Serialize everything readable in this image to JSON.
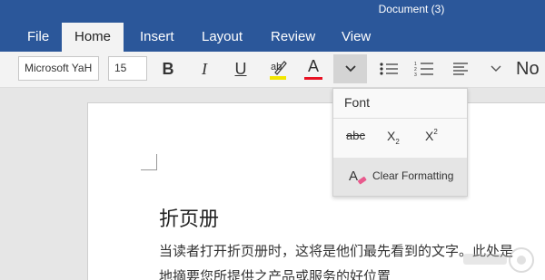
{
  "window": {
    "title": "Document (3)"
  },
  "tabs": [
    {
      "label": "File"
    },
    {
      "label": "Home",
      "active": true
    },
    {
      "label": "Insert"
    },
    {
      "label": "Layout"
    },
    {
      "label": "Review"
    },
    {
      "label": "View"
    }
  ],
  "ribbon": {
    "font_name": "Microsoft YaH",
    "font_size": "15",
    "bold_label": "B",
    "italic_label": "I",
    "underline_label": "U",
    "font_color_label": "A",
    "styles_label": "No",
    "colors": {
      "highlight": "#f2e600",
      "font_color": "#e81123",
      "accent": "#2b579a"
    }
  },
  "font_panel": {
    "title": "Font",
    "strikethrough_label": "abc",
    "subscript_label": "X",
    "subscript_mark": "2",
    "superscript_label": "X",
    "superscript_mark": "2",
    "clear_formatting_label": "Clear Formatting"
  },
  "document": {
    "heading": "折页册",
    "line1": "当读者打开折页册时，这将是他们最先看到的文字。此处是",
    "line2": "地摘要您所提供之产品或服务的好位置"
  }
}
